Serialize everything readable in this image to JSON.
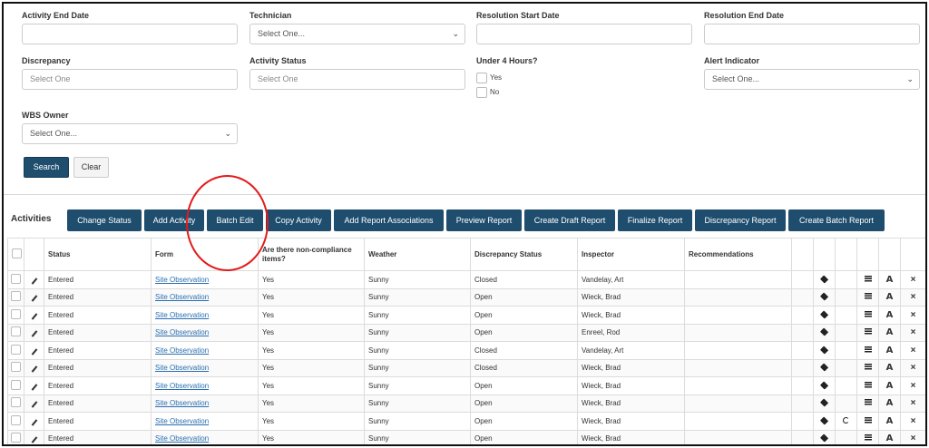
{
  "filters": {
    "activity_end_date": {
      "label": "Activity End Date",
      "value": ""
    },
    "technician": {
      "label": "Technician",
      "value": "Select One..."
    },
    "resolution_start_date": {
      "label": "Resolution Start Date",
      "value": ""
    },
    "resolution_end_date": {
      "label": "Resolution End Date",
      "value": ""
    },
    "discrepancy": {
      "label": "Discrepancy",
      "placeholder": "Select One"
    },
    "activity_status": {
      "label": "Activity Status",
      "placeholder": "Select One"
    },
    "under_4_hours": {
      "label": "Under 4 Hours?",
      "yes": "Yes",
      "no": "No"
    },
    "alert_indicator": {
      "label": "Alert Indicator",
      "value": "Select One..."
    },
    "wbs_owner": {
      "label": "WBS Owner",
      "value": "Select One..."
    },
    "search_label": "Search",
    "clear_label": "Clear"
  },
  "toolbar": {
    "label": "Activities",
    "buttons": [
      "Change Status",
      "Add Activity",
      "Batch Edit",
      "Copy Activity",
      "Add Report Associations",
      "Preview Report",
      "Create Draft Report",
      "Finalize Report",
      "Discrepancy Report",
      "Create Batch Report"
    ]
  },
  "table": {
    "headers": [
      "Status",
      "Form",
      "Are there non-compliance items?",
      "Weather",
      "Discrepancy Status",
      "Inspector",
      "Recommendations"
    ],
    "rows": [
      {
        "status": "Entered",
        "form": "Site Observation",
        "noncompliance": "Yes",
        "weather": "Sunny",
        "discrepancy_status": "Closed",
        "inspector": "Vandelay, Art",
        "recommendations": "",
        "refresh": false
      },
      {
        "status": "Entered",
        "form": "Site Observation",
        "noncompliance": "Yes",
        "weather": "Sunny",
        "discrepancy_status": "Open",
        "inspector": "Wieck, Brad",
        "recommendations": "",
        "refresh": false
      },
      {
        "status": "Entered",
        "form": "Site Observation",
        "noncompliance": "Yes",
        "weather": "Sunny",
        "discrepancy_status": "Open",
        "inspector": "Wieck, Brad",
        "recommendations": "",
        "refresh": false
      },
      {
        "status": "Entered",
        "form": "Site Observation",
        "noncompliance": "Yes",
        "weather": "Sunny",
        "discrepancy_status": "Open",
        "inspector": "Enreel, Rod",
        "recommendations": "",
        "refresh": false
      },
      {
        "status": "Entered",
        "form": "Site Observation",
        "noncompliance": "Yes",
        "weather": "Sunny",
        "discrepancy_status": "Closed",
        "inspector": "Vandelay, Art",
        "recommendations": "",
        "refresh": false
      },
      {
        "status": "Entered",
        "form": "Site Observation",
        "noncompliance": "Yes",
        "weather": "Sunny",
        "discrepancy_status": "Closed",
        "inspector": "Wieck, Brad",
        "recommendations": "",
        "refresh": false
      },
      {
        "status": "Entered",
        "form": "Site Observation",
        "noncompliance": "Yes",
        "weather": "Sunny",
        "discrepancy_status": "Open",
        "inspector": "Wieck, Brad",
        "recommendations": "",
        "refresh": false
      },
      {
        "status": "Entered",
        "form": "Site Observation",
        "noncompliance": "Yes",
        "weather": "Sunny",
        "discrepancy_status": "Open",
        "inspector": "Wieck, Brad",
        "recommendations": "",
        "refresh": false
      },
      {
        "status": "Entered",
        "form": "Site Observation",
        "noncompliance": "Yes",
        "weather": "Sunny",
        "discrepancy_status": "Open",
        "inspector": "Wieck, Brad",
        "recommendations": "",
        "refresh": true
      },
      {
        "status": "Entered",
        "form": "Site Observation",
        "noncompliance": "Yes",
        "weather": "Sunny",
        "discrepancy_status": "Open",
        "inspector": "Wieck, Brad",
        "recommendations": "",
        "refresh": false
      }
    ]
  },
  "icons": {
    "edit": "pencil-icon",
    "tag": "tag-icon",
    "refresh": "refresh-icon",
    "calculator": "calculator-icon",
    "font": "font-icon",
    "delete": "close-icon"
  },
  "colors": {
    "primary_button": "#1e4d6e",
    "link": "#2a6fb0",
    "annotation": "#e31b1b"
  }
}
